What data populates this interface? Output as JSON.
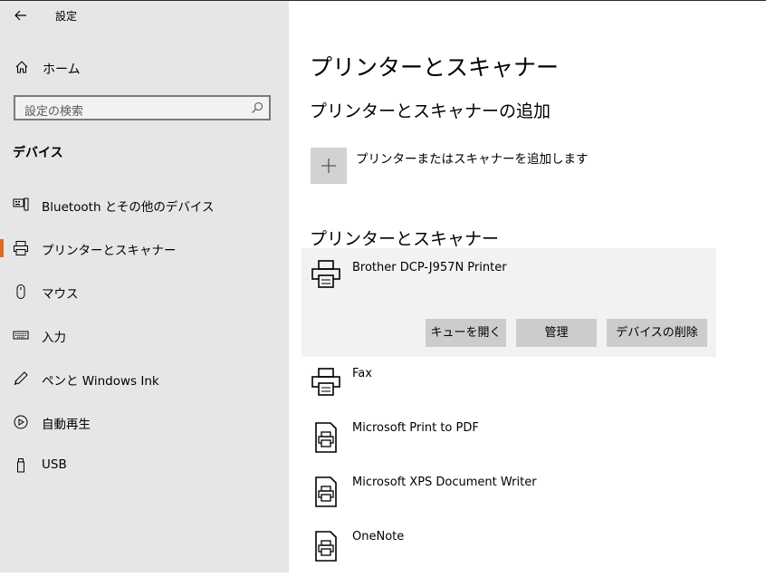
{
  "app": {
    "title": "設定"
  },
  "sidebar": {
    "home_label": "ホーム",
    "search_placeholder": "設定の検索",
    "section_title": "デバイス",
    "items": [
      {
        "label": "Bluetooth とその他のデバイス",
        "icon": "bluetooth-devices-icon",
        "active": false
      },
      {
        "label": "プリンターとスキャナー",
        "icon": "printer-icon",
        "active": true
      },
      {
        "label": "マウス",
        "icon": "mouse-icon",
        "active": false
      },
      {
        "label": "入力",
        "icon": "keyboard-icon",
        "active": false
      },
      {
        "label": "ペンと Windows Ink",
        "icon": "pen-icon",
        "active": false
      },
      {
        "label": "自動再生",
        "icon": "autoplay-icon",
        "active": false
      },
      {
        "label": "USB",
        "icon": "usb-icon",
        "active": false
      }
    ]
  },
  "main": {
    "page_title": "プリンターとスキャナー",
    "add_section_title": "プリンターとスキャナーの追加",
    "add_label": "プリンターまたはスキャナーを追加します",
    "list_title": "プリンターとスキャナー",
    "selected_printer": {
      "name": "Brother DCP-J957N Printer",
      "buttons": {
        "open_queue": "キューを開く",
        "manage": "管理",
        "remove": "デバイスの削除"
      }
    },
    "devices": [
      {
        "name": "Fax",
        "icon": "printer-icon"
      },
      {
        "name": "Microsoft Print to PDF",
        "icon": "document-printer-icon"
      },
      {
        "name": "Microsoft XPS Document Writer",
        "icon": "document-printer-icon"
      },
      {
        "name": "OneNote",
        "icon": "document-printer-icon"
      }
    ]
  },
  "colors": {
    "sidebar_bg": "#e6e6e6",
    "accent": "#e06b1f",
    "selected_row_bg": "#f2f2f2",
    "button_bg": "#cccccc"
  }
}
